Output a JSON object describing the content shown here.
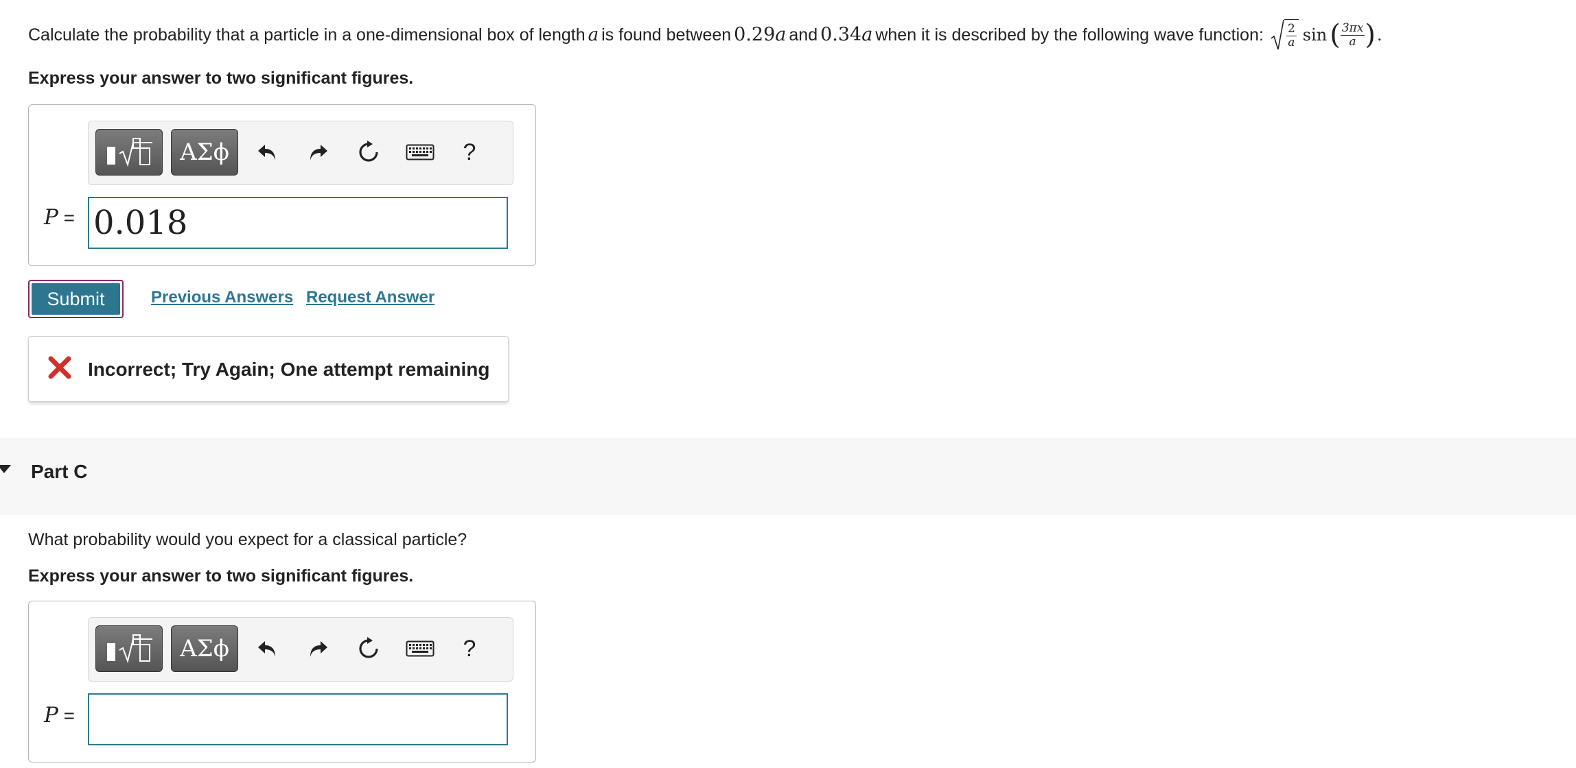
{
  "partB": {
    "question": {
      "prefix": "Calculate the probability that a particle in a one-dimensional box of length",
      "var_a": "a",
      "between": "is found between",
      "lower": "0.29",
      "and": "and",
      "upper": "0.34",
      "suffix": "when it is described by the following wave function:",
      "formula": {
        "sqrt_num": "2",
        "sqrt_den": "a",
        "func": "sin",
        "arg_num": "3πx",
        "arg_den": "a",
        "trail": "."
      }
    },
    "instruction": "Express your answer to two significant figures.",
    "toolbar": {
      "greek_label": "ΑΣϕ",
      "help_label": "?"
    },
    "answer_label": "P",
    "answer_eq": "=",
    "answer_value": "0.018",
    "submit_label": "Submit",
    "previous_answers_label": "Previous Answers",
    "request_answer_label": "Request Answer",
    "feedback": "Incorrect; Try Again; One attempt remaining"
  },
  "partC": {
    "title": "Part C",
    "question": "What probability would you expect for a classical particle?",
    "instruction": "Express your answer to two significant figures.",
    "toolbar": {
      "greek_label": "ΑΣϕ",
      "help_label": "?"
    },
    "answer_label": "P",
    "answer_eq": "=",
    "answer_value": ""
  },
  "colors": {
    "accent": "#2c7690",
    "error": "#d0312d",
    "input_border": "#2b7a8e"
  }
}
